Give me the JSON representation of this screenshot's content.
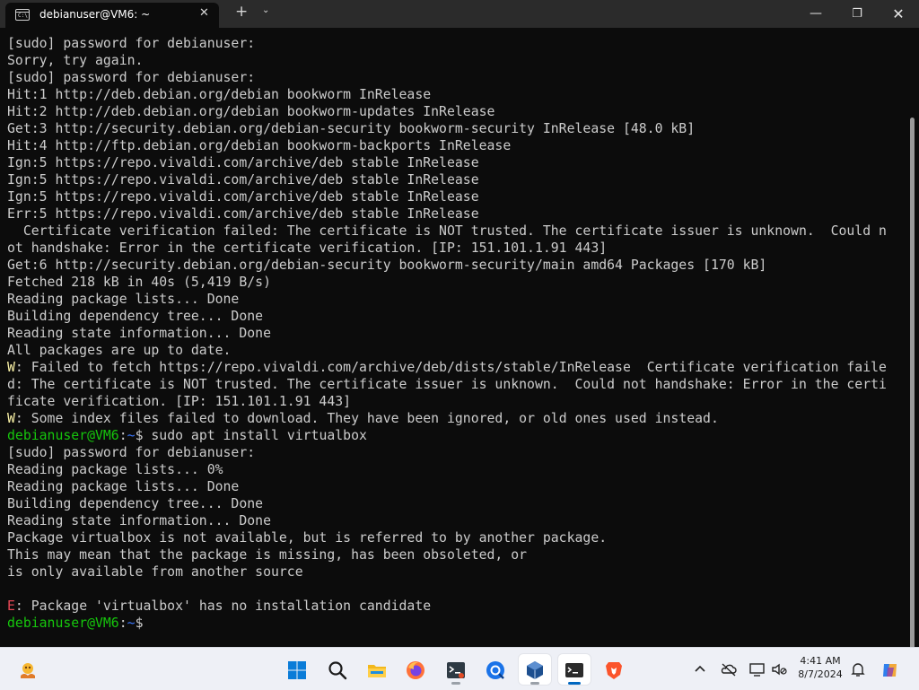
{
  "window": {
    "tab_title": "debianuser@VM6: ~",
    "tab_icon_text": "C:\\",
    "new_tab_label": "+",
    "dropdown_label": "⌄",
    "minimize_label": "—",
    "maximize_label": "❐",
    "close_label": "✕",
    "tab_close_label": "✕"
  },
  "terminal": {
    "lines": [
      [
        {
          "t": "[sudo] password for debianuser:"
        }
      ],
      [
        {
          "t": "Sorry, try again."
        }
      ],
      [
        {
          "t": "[sudo] password for debianuser:"
        }
      ],
      [
        {
          "t": "Hit:1 http://deb.debian.org/debian bookworm InRelease"
        }
      ],
      [
        {
          "t": "Hit:2 http://deb.debian.org/debian bookworm-updates InRelease"
        }
      ],
      [
        {
          "t": "Get:3 http://security.debian.org/debian-security bookworm-security InRelease [48.0 kB]"
        }
      ],
      [
        {
          "t": "Hit:4 http://ftp.debian.org/debian bookworm-backports InRelease"
        }
      ],
      [
        {
          "t": "Ign:5 https://repo.vivaldi.com/archive/deb stable InRelease"
        }
      ],
      [
        {
          "t": "Ign:5 https://repo.vivaldi.com/archive/deb stable InRelease"
        }
      ],
      [
        {
          "t": "Ign:5 https://repo.vivaldi.com/archive/deb stable InRelease"
        }
      ],
      [
        {
          "t": "Err:5 https://repo.vivaldi.com/archive/deb stable InRelease"
        }
      ],
      [
        {
          "t": "  Certificate verification failed: The certificate is NOT trusted. The certificate issuer is unknown.  Could n"
        }
      ],
      [
        {
          "t": "ot handshake: Error in the certificate verification. [IP: 151.101.1.91 443]"
        }
      ],
      [
        {
          "t": "Get:6 http://security.debian.org/debian-security bookworm-security/main amd64 Packages [170 kB]"
        }
      ],
      [
        {
          "t": "Fetched 218 kB in 40s (5,419 B/s)"
        }
      ],
      [
        {
          "t": "Reading package lists... Done"
        }
      ],
      [
        {
          "t": "Building dependency tree... Done"
        }
      ],
      [
        {
          "t": "Reading state information... Done"
        }
      ],
      [
        {
          "t": "All packages are up to date."
        }
      ],
      [
        {
          "t": "W",
          "c": "warn"
        },
        {
          "t": ": Failed to fetch https://repo.vivaldi.com/archive/deb/dists/stable/InRelease  Certificate verification faile"
        }
      ],
      [
        {
          "t": "d: The certificate is NOT trusted. The certificate issuer is unknown.  Could not handshake: Error in the certi"
        }
      ],
      [
        {
          "t": "ficate verification. [IP: 151.101.1.91 443]"
        }
      ],
      [
        {
          "t": "W",
          "c": "warn"
        },
        {
          "t": ": Some index files failed to download. They have been ignored, or old ones used instead."
        }
      ],
      [
        {
          "t": "debianuser@VM6",
          "c": "prompt"
        },
        {
          "t": ":"
        },
        {
          "t": "~",
          "c": "path"
        },
        {
          "t": "$ sudo apt install virtualbox"
        }
      ],
      [
        {
          "t": "[sudo] password for debianuser:"
        }
      ],
      [
        {
          "t": "Reading package lists... 0%"
        }
      ],
      [
        {
          "t": "Reading package lists... Done"
        }
      ],
      [
        {
          "t": "Building dependency tree... Done"
        }
      ],
      [
        {
          "t": "Reading state information... Done"
        }
      ],
      [
        {
          "t": "Package virtualbox is not available, but is referred to by another package."
        }
      ],
      [
        {
          "t": "This may mean that the package is missing, has been obsoleted, or"
        }
      ],
      [
        {
          "t": "is only available from another source"
        }
      ],
      [
        {
          "t": ""
        }
      ],
      [
        {
          "t": "E",
          "c": "err"
        },
        {
          "t": ": Package 'virtualbox' has no installation candidate"
        }
      ],
      [
        {
          "t": "debianuser@VM6",
          "c": "prompt"
        },
        {
          "t": ":"
        },
        {
          "t": "~",
          "c": "path"
        },
        {
          "t": "$ "
        }
      ]
    ]
  },
  "taskbar": {
    "apps": [
      {
        "name": "weather-widget",
        "icon": "weather-icon"
      },
      {
        "name": "start",
        "icon": "windows-logo-icon"
      },
      {
        "name": "search",
        "icon": "search-icon"
      },
      {
        "name": "file-explorer",
        "icon": "folder-icon"
      },
      {
        "name": "firefox",
        "icon": "firefox-icon"
      },
      {
        "name": "git-bash",
        "icon": "git-bash-icon"
      },
      {
        "name": "browser",
        "icon": "browser-icon"
      },
      {
        "name": "virtualbox",
        "icon": "virtualbox-icon"
      },
      {
        "name": "terminal",
        "icon": "terminal-icon"
      },
      {
        "name": "brave",
        "icon": "brave-icon"
      }
    ],
    "clock": {
      "time": "4:41 AM",
      "date": "8/7/2024"
    }
  },
  "colors": {
    "prompt": "#16c60c",
    "warning": "#f9f1a5",
    "error": "#e74856",
    "path": "#3b78ff",
    "terminal_bg": "#0c0c0c",
    "terminal_fg": "#cccccc"
  }
}
